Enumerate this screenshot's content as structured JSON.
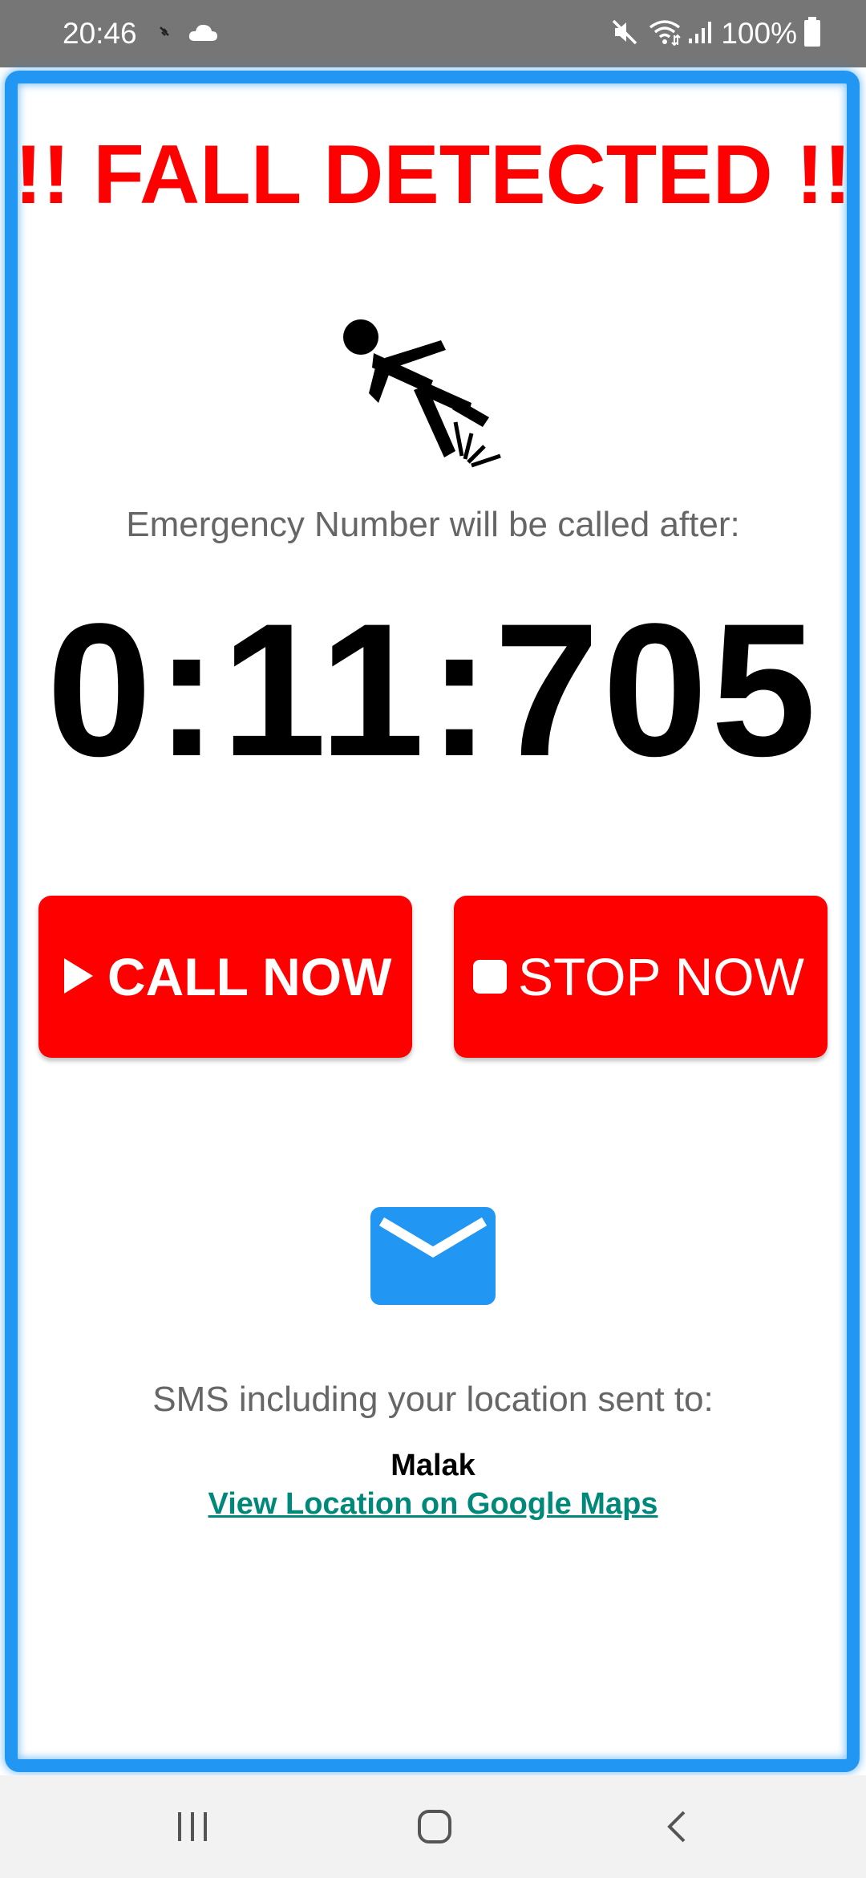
{
  "status_bar": {
    "time": "20:46",
    "left_icons": [
      "antenna-icon",
      "cloud-icon"
    ],
    "right_icons": [
      "mute-icon",
      "wifi-icon",
      "signal-icon",
      "battery-icon"
    ],
    "battery": "100%"
  },
  "alert": {
    "title": "!! FALL DETECTED !!",
    "icon": "falling-person-icon",
    "subtitle": "Emergency Number will be called after:",
    "countdown": "0:11:705"
  },
  "buttons": {
    "call_label": "CALL NOW",
    "call_icon": "play-icon",
    "stop_label": "STOP NOW",
    "stop_icon": "stop-icon"
  },
  "sms": {
    "icon": "mail-icon",
    "text": "SMS including your location sent to:",
    "contact": "Malak",
    "link_label": "View Location on Google Maps"
  },
  "nav_bar": {
    "buttons": [
      "recent-apps-icon",
      "home-icon",
      "back-icon"
    ]
  },
  "colors": {
    "frame": "#2196f3",
    "alert_red": "#ff0000",
    "link": "#00897b",
    "mail": "#2196f3"
  }
}
